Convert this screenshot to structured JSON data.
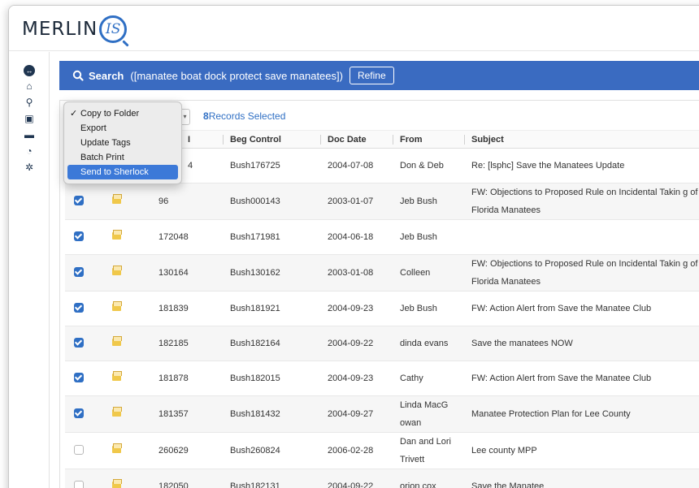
{
  "app": {
    "logo_text": "MERLIN",
    "logo_suffix": "IS"
  },
  "sidebar": {
    "items": [
      {
        "name": "toggle-icon",
        "glyph": "↔"
      },
      {
        "name": "home-icon",
        "glyph": "⌂"
      },
      {
        "name": "search-icon",
        "glyph": "⚲"
      },
      {
        "name": "save-icon",
        "glyph": "▣"
      },
      {
        "name": "folder-icon",
        "glyph": "▬"
      },
      {
        "name": "pie-chart-icon",
        "glyph": "◔"
      },
      {
        "name": "settings-icon",
        "glyph": "✲"
      }
    ]
  },
  "search": {
    "label": "Search",
    "query": "([manatee boat dock protect save manatees])",
    "refine_label": "Refine"
  },
  "toolbar": {
    "selected_count": "8",
    "selected_label": "Records Selected"
  },
  "action_menu": {
    "items": [
      {
        "label": "Copy to Folder",
        "checked": true,
        "highlight": false
      },
      {
        "label": "Export",
        "checked": false,
        "highlight": false
      },
      {
        "label": "Update Tags",
        "checked": false,
        "highlight": false
      },
      {
        "label": "Batch Print",
        "checked": false,
        "highlight": false
      },
      {
        "label": "Send to Sherlock",
        "checked": false,
        "highlight": true
      }
    ]
  },
  "table": {
    "columns": [
      "",
      "",
      "I",
      "Beg Control",
      "Doc Date",
      "From",
      "Subject"
    ],
    "rows": [
      {
        "checked": true,
        "docid": "4",
        "beg": "Bush176725",
        "date": "2004-07-08",
        "from": "Don & Deb",
        "subject": "Re: [lsphc] Save the Manatees Update"
      },
      {
        "checked": true,
        "docid": "96",
        "beg": "Bush000143",
        "date": "2003-01-07",
        "from": "Jeb Bush",
        "subject": "FW: Objections to Proposed Rule on Incidental Takin g of Florida Manatees"
      },
      {
        "checked": true,
        "docid": "172048",
        "beg": "Bush171981",
        "date": "2004-06-18",
        "from": "Jeb Bush",
        "subject": ""
      },
      {
        "checked": true,
        "docid": "130164",
        "beg": "Bush130162",
        "date": "2003-01-08",
        "from": "Colleen",
        "subject": "FW: Objections to Proposed Rule on Incidental Takin g of Florida Manatees"
      },
      {
        "checked": true,
        "docid": "181839",
        "beg": "Bush181921",
        "date": "2004-09-23",
        "from": "Jeb Bush",
        "subject": "FW: Action Alert from Save the Manatee Club"
      },
      {
        "checked": true,
        "docid": "182185",
        "beg": "Bush182164",
        "date": "2004-09-22",
        "from": "dinda evans",
        "subject": "Save the manatees NOW"
      },
      {
        "checked": true,
        "docid": "181878",
        "beg": "Bush182015",
        "date": "2004-09-23",
        "from": "Cathy",
        "subject": "FW: Action Alert from Save the Manatee Club"
      },
      {
        "checked": true,
        "docid": "181357",
        "beg": "Bush181432",
        "date": "2004-09-27",
        "from": "Linda MacG owan",
        "subject": "Manatee Protection Plan for Lee County"
      },
      {
        "checked": false,
        "docid": "260629",
        "beg": "Bush260824",
        "date": "2006-02-28",
        "from": "Dan and Lori Trivett",
        "subject": "Lee county MPP"
      },
      {
        "checked": false,
        "docid": "182050",
        "beg": "Bush182131",
        "date": "2004-09-22",
        "from": "orion cox",
        "subject": "Save the Manatee"
      }
    ]
  }
}
